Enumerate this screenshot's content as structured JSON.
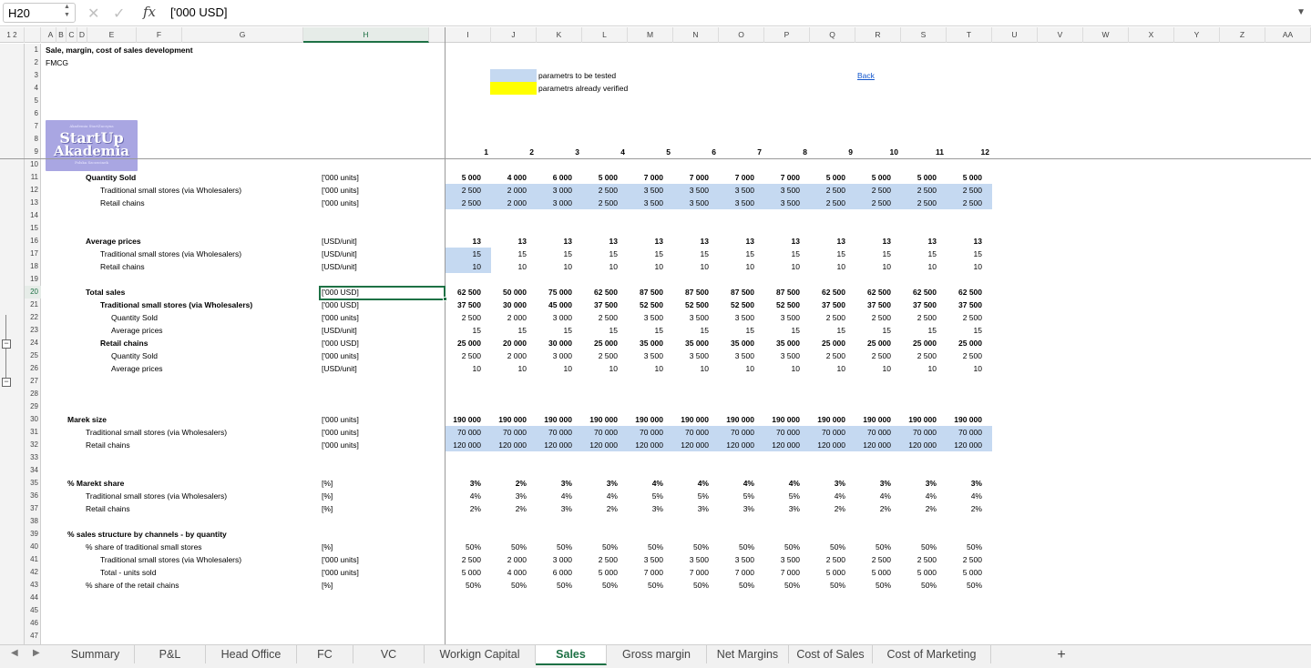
{
  "formula_bar": {
    "name_box": "H20",
    "formula": "['000 USD]",
    "fx": "fx"
  },
  "columns": [
    "A",
    "B",
    "C",
    "D",
    "E",
    "F",
    "G",
    "H",
    "I",
    "J",
    "K",
    "L",
    "M",
    "N",
    "O",
    "P",
    "Q",
    "R",
    "S",
    "T",
    "U",
    "V",
    "W",
    "X",
    "Y",
    "Z",
    "AA"
  ],
  "outline_levels": [
    "1",
    "2"
  ],
  "rows": [
    "1",
    "2",
    "3",
    "4",
    "5",
    "6",
    "7",
    "8",
    "9",
    "10",
    "11",
    "12",
    "13",
    "14",
    "15",
    "16",
    "17",
    "18",
    "19",
    "20",
    "21",
    "22",
    "23",
    "24",
    "25",
    "26",
    "27",
    "28",
    "29",
    "30",
    "31",
    "32",
    "33",
    "34",
    "35",
    "36",
    "37",
    "38",
    "39",
    "40",
    "41",
    "42",
    "43",
    "44",
    "45",
    "46",
    "47"
  ],
  "header": {
    "title": "Sale, margin, cost of sales development",
    "subtitle": "FMCG",
    "back_link": "Back"
  },
  "logo": {
    "top": "Akademia StartZaczyna",
    "line1": "StartUp",
    "line2": "Akademia",
    "bottom": "Polska Szczecinek"
  },
  "legend": [
    {
      "label": "parametrs to be tested",
      "color": "#c5d9f1"
    },
    {
      "label": "parametrs already verified",
      "color": "#ffff00"
    }
  ],
  "periods": [
    "1",
    "2",
    "3",
    "4",
    "5",
    "6",
    "7",
    "8",
    "9",
    "10",
    "11",
    "12"
  ],
  "data_rows": [
    {
      "label": "Quantity Sold",
      "unit": "['000 units]",
      "values": [
        "5 000",
        "4 000",
        "6 000",
        "5 000",
        "7 000",
        "7 000",
        "7 000",
        "7 000",
        "5 000",
        "5 000",
        "5 000",
        "5 000"
      ]
    },
    {
      "label": "Traditional small stores (via Wholesalers)",
      "unit": "['000 units]",
      "values": [
        "2 500",
        "2 000",
        "3 000",
        "2 500",
        "3 500",
        "3 500",
        "3 500",
        "3 500",
        "2 500",
        "2 500",
        "2 500",
        "2 500"
      ]
    },
    {
      "label": "Retail chains",
      "unit": "['000 units]",
      "values": [
        "2 500",
        "2 000",
        "3 000",
        "2 500",
        "3 500",
        "3 500",
        "3 500",
        "3 500",
        "2 500",
        "2 500",
        "2 500",
        "2 500"
      ]
    },
    {
      "label": "Average prices",
      "unit": "[USD/unit]",
      "values": [
        "13",
        "13",
        "13",
        "13",
        "13",
        "13",
        "13",
        "13",
        "13",
        "13",
        "13",
        "13"
      ]
    },
    {
      "label": "Traditional small stores (via Wholesalers)",
      "unit": "[USD/unit]",
      "values": [
        "15",
        "15",
        "15",
        "15",
        "15",
        "15",
        "15",
        "15",
        "15",
        "15",
        "15",
        "15"
      ]
    },
    {
      "label": "Retail chains",
      "unit": "[USD/unit]",
      "values": [
        "10",
        "10",
        "10",
        "10",
        "10",
        "10",
        "10",
        "10",
        "10",
        "10",
        "10",
        "10"
      ]
    },
    {
      "label": "Total sales",
      "unit": "['000 USD]",
      "values": [
        "62 500",
        "50 000",
        "75 000",
        "62 500",
        "87 500",
        "87 500",
        "87 500",
        "87 500",
        "62 500",
        "62 500",
        "62 500",
        "62 500"
      ]
    },
    {
      "label": "Traditional small stores (via Wholesalers)",
      "unit": "['000 USD]",
      "values": [
        "37 500",
        "30 000",
        "45 000",
        "37 500",
        "52 500",
        "52 500",
        "52 500",
        "52 500",
        "37 500",
        "37 500",
        "37 500",
        "37 500"
      ]
    },
    {
      "label": "Quantity Sold",
      "unit": "['000 units]",
      "values": [
        "2 500",
        "2 000",
        "3 000",
        "2 500",
        "3 500",
        "3 500",
        "3 500",
        "3 500",
        "2 500",
        "2 500",
        "2 500",
        "2 500"
      ]
    },
    {
      "label": "Average prices",
      "unit": "[USD/unit]",
      "values": [
        "15",
        "15",
        "15",
        "15",
        "15",
        "15",
        "15",
        "15",
        "15",
        "15",
        "15",
        "15"
      ]
    },
    {
      "label": "Retail chains",
      "unit": "['000 USD]",
      "values": [
        "25 000",
        "20 000",
        "30 000",
        "25 000",
        "35 000",
        "35 000",
        "35 000",
        "35 000",
        "25 000",
        "25 000",
        "25 000",
        "25 000"
      ]
    },
    {
      "label": "Quantity Sold",
      "unit": "['000 units]",
      "values": [
        "2 500",
        "2 000",
        "3 000",
        "2 500",
        "3 500",
        "3 500",
        "3 500",
        "3 500",
        "2 500",
        "2 500",
        "2 500",
        "2 500"
      ]
    },
    {
      "label": "Average prices",
      "unit": "[USD/unit]",
      "values": [
        "10",
        "10",
        "10",
        "10",
        "10",
        "10",
        "10",
        "10",
        "10",
        "10",
        "10",
        "10"
      ]
    },
    {
      "label": "Marek size",
      "unit": "['000 units]",
      "values": [
        "190 000",
        "190 000",
        "190 000",
        "190 000",
        "190 000",
        "190 000",
        "190 000",
        "190 000",
        "190 000",
        "190 000",
        "190 000",
        "190 000"
      ]
    },
    {
      "label": "Traditional small stores (via Wholesalers)",
      "unit": "['000 units]",
      "values": [
        "70 000",
        "70 000",
        "70 000",
        "70 000",
        "70 000",
        "70 000",
        "70 000",
        "70 000",
        "70 000",
        "70 000",
        "70 000",
        "70 000"
      ]
    },
    {
      "label": "Retail chains",
      "unit": "['000 units]",
      "values": [
        "120 000",
        "120 000",
        "120 000",
        "120 000",
        "120 000",
        "120 000",
        "120 000",
        "120 000",
        "120 000",
        "120 000",
        "120 000",
        "120 000"
      ]
    },
    {
      "label": "% Marekt share",
      "unit": "[%]",
      "values": [
        "3%",
        "2%",
        "3%",
        "3%",
        "4%",
        "4%",
        "4%",
        "4%",
        "3%",
        "3%",
        "3%",
        "3%"
      ]
    },
    {
      "label": "Traditional small stores (via Wholesalers)",
      "unit": "[%]",
      "values": [
        "4%",
        "3%",
        "4%",
        "4%",
        "5%",
        "5%",
        "5%",
        "5%",
        "4%",
        "4%",
        "4%",
        "4%"
      ]
    },
    {
      "label": "Retail chains",
      "unit": "[%]",
      "values": [
        "2%",
        "2%",
        "3%",
        "2%",
        "3%",
        "3%",
        "3%",
        "3%",
        "2%",
        "2%",
        "2%",
        "2%"
      ]
    },
    {
      "label": "% sales structure by channels - by quantity",
      "unit": "",
      "values": []
    },
    {
      "label": "% share of traditional small stores",
      "unit": "[%]",
      "values": [
        "50%",
        "50%",
        "50%",
        "50%",
        "50%",
        "50%",
        "50%",
        "50%",
        "50%",
        "50%",
        "50%",
        "50%"
      ]
    },
    {
      "label": "Traditional small stores (via Wholesalers)",
      "unit": "['000 units]",
      "values": [
        "2 500",
        "2 000",
        "3 000",
        "2 500",
        "3 500",
        "3 500",
        "3 500",
        "3 500",
        "2 500",
        "2 500",
        "2 500",
        "2 500"
      ]
    },
    {
      "label": "Total - units sold",
      "unit": "['000 units]",
      "values": [
        "5 000",
        "4 000",
        "6 000",
        "5 000",
        "7 000",
        "7 000",
        "7 000",
        "7 000",
        "5 000",
        "5 000",
        "5 000",
        "5 000"
      ]
    },
    {
      "label": "% share of the retail chains",
      "unit": "[%]",
      "values": [
        "50%",
        "50%",
        "50%",
        "50%",
        "50%",
        "50%",
        "50%",
        "50%",
        "50%",
        "50%",
        "50%",
        "50%"
      ]
    }
  ],
  "sheet_tabs": [
    "Summary",
    "P&L",
    "Head Office",
    "FC",
    "VC",
    "Workign Capital",
    "Sales",
    "Gross margin",
    "Net Margins",
    "Cost of Sales",
    "Cost of Marketing"
  ],
  "active_tab": "Sales",
  "add_sheet": "+",
  "colors": {
    "accent": "#1e7145",
    "tested": "#c5d9f1",
    "verified": "#ffff00"
  }
}
